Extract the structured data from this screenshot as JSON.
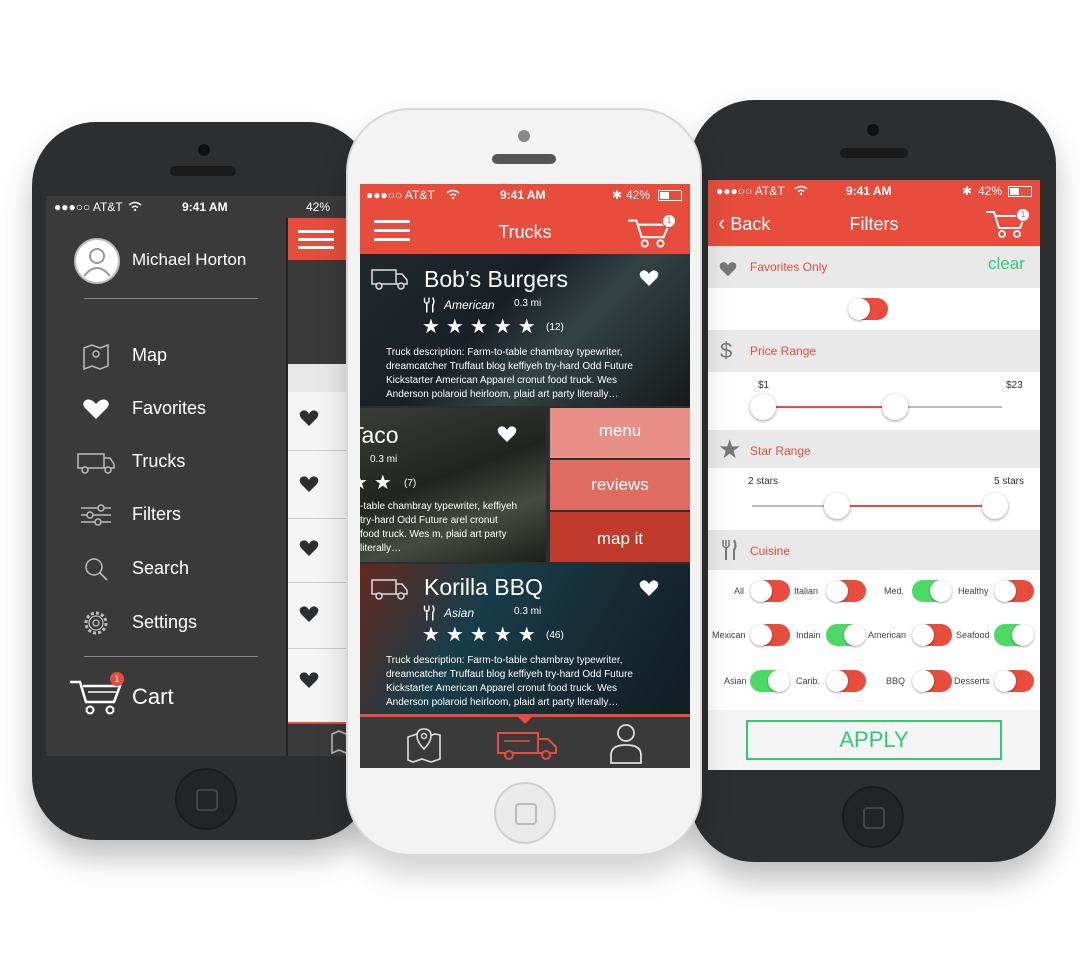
{
  "status": {
    "carrier": "●●●○○ AT&T",
    "time": "9:41 AM",
    "battery": "42%"
  },
  "colors": {
    "accent": "#e74c3c",
    "green": "#4cd964",
    "dark": "#2d2e30"
  },
  "left": {
    "user_name": "Michael Horton",
    "menu": [
      {
        "label": "Map",
        "icon": "map-icon"
      },
      {
        "label": "Favorites",
        "icon": "heart-icon"
      },
      {
        "label": "Trucks",
        "icon": "truck-icon"
      },
      {
        "label": "Filters",
        "icon": "sliders-icon"
      },
      {
        "label": "Search",
        "icon": "search-icon"
      },
      {
        "label": "Settings",
        "icon": "gear-icon"
      }
    ],
    "cart_label": "Cart",
    "cart_count": "1"
  },
  "middle": {
    "title": "Trucks",
    "cart_count": "1",
    "trucks": [
      {
        "name": "Bob’s Burgers",
        "cuisine": "American",
        "distance": "0.3 mi",
        "reviews": "(12)",
        "description": "Truck description: Farm-to-table chambray typewriter, dreamcatcher Truffaut blog keffiyeh try-hard Odd Future Kickstarter American Apparel cronut food truck. Wes Anderson polaroid heirloom, plaid art party literally…"
      },
      {
        "name": "Taco",
        "distance": "0.3 mi",
        "reviews": "(7)",
        "description": "-table chambray typewriter, keffiyeh try-hard Odd Future arel cronut food truck. Wes m, plaid art party literally…"
      },
      {
        "name": "Korilla BBQ",
        "cuisine": "Asian",
        "distance": "0.3 mi",
        "reviews": "(46)",
        "description": "Truck description: Farm-to-table chambray typewriter, dreamcatcher Truffaut blog keffiyeh try-hard Odd Future Kickstarter American Apparel cronut food truck. Wes Anderson polaroid heirloom, plaid art party literally…"
      }
    ],
    "actions": {
      "menu": "menu",
      "reviews": "reviews",
      "map": "map it"
    }
  },
  "right": {
    "back": "Back",
    "title": "Filters",
    "cart_count": "1",
    "clear": "clear",
    "favorites_only": "Favorites Only",
    "price_range": {
      "label": "Price Range",
      "min_label": "$1",
      "max_label": "$23",
      "min": 1,
      "max": 23
    },
    "star_range": {
      "label": "Star Range",
      "min_label": "2 stars",
      "max_label": "5 stars"
    },
    "cuisine_label": "Cuisine",
    "cuisines": [
      {
        "label": "All",
        "on": false
      },
      {
        "label": "Italian",
        "on": false
      },
      {
        "label": "Med.",
        "on": true
      },
      {
        "label": "Healthy",
        "on": false
      },
      {
        "label": "Mexican",
        "on": false
      },
      {
        "label": "Indain",
        "on": true
      },
      {
        "label": "American",
        "on": false
      },
      {
        "label": "Seafood",
        "on": true
      },
      {
        "label": "Asian",
        "on": true
      },
      {
        "label": "Carib.",
        "on": false
      },
      {
        "label": "BBQ",
        "on": false
      },
      {
        "label": "Desserts",
        "on": false
      }
    ],
    "apply": "APPLY"
  }
}
